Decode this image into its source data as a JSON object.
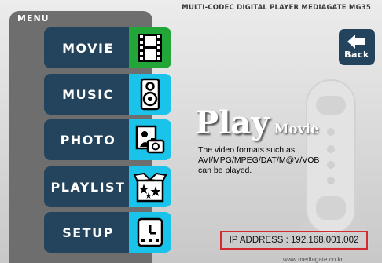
{
  "header": {
    "product_title": "MULTI-CODEC DIGITAL PLAYER MEDIAGATE MG35"
  },
  "menu": {
    "label": "MENU",
    "items": [
      {
        "label": "MOVIE",
        "icon": "film-icon",
        "selected": true
      },
      {
        "label": "MUSIC",
        "icon": "speaker-icon",
        "selected": false
      },
      {
        "label": "PHOTO",
        "icon": "photo-camera-icon",
        "selected": false
      },
      {
        "label": "PLAYLIST",
        "icon": "star-box-icon",
        "selected": false
      },
      {
        "label": "SETUP",
        "icon": "clock-device-icon",
        "selected": false
      }
    ]
  },
  "back_button": {
    "label": "Back",
    "icon": "back-arrow-icon"
  },
  "content": {
    "title_main": "Play",
    "title_sub": "Movie",
    "description_lines": [
      "The video formats such as",
      "AVI/MPG/MPEG/DAT/M@V/VOB",
      "can be played."
    ]
  },
  "status": {
    "ip_address": "IP ADDRESS : 192.168.001.002"
  },
  "footer": {
    "url": "www.mediagate.co.kr"
  },
  "colors": {
    "menu_button": "#23445c",
    "icon_tile": "#19c3ea",
    "icon_tile_selected": "#23a638",
    "ip_border": "#d6292f"
  }
}
